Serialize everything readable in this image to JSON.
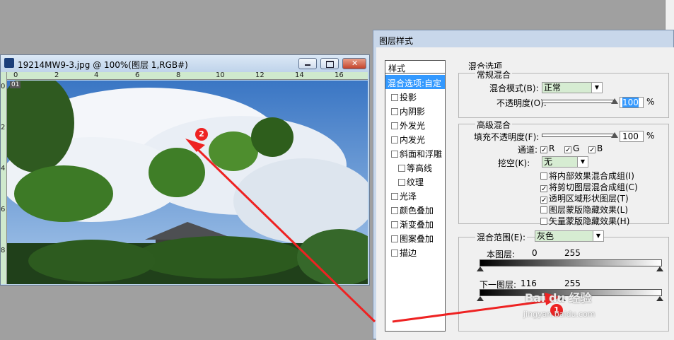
{
  "image_window": {
    "title": "19214MW9-3.jpg @ 100%(图层 1,RGB#)",
    "ruler_top_ticks": [
      "0",
      "2",
      "4",
      "6",
      "8",
      "10",
      "12",
      "14",
      "16"
    ],
    "ruler_left_ticks": [
      "0",
      "2",
      "4",
      "6",
      "8"
    ],
    "layer_badge": "01"
  },
  "dialog": {
    "title": "图层样式",
    "styles_header": "样式",
    "styles": [
      {
        "label": "混合选项:自定",
        "selected": true,
        "checkbox": false
      },
      {
        "label": "投影",
        "checkbox": true
      },
      {
        "label": "内阴影",
        "checkbox": true
      },
      {
        "label": "外发光",
        "checkbox": true
      },
      {
        "label": "内发光",
        "checkbox": true
      },
      {
        "label": "斜面和浮雕",
        "checkbox": true
      },
      {
        "label": "等高线",
        "checkbox": true,
        "indent": true
      },
      {
        "label": "纹理",
        "checkbox": true,
        "indent": true
      },
      {
        "label": "光泽",
        "checkbox": true
      },
      {
        "label": "颜色叠加",
        "checkbox": true
      },
      {
        "label": "渐变叠加",
        "checkbox": true
      },
      {
        "label": "图案叠加",
        "checkbox": true
      },
      {
        "label": "描边",
        "checkbox": true
      }
    ],
    "blend_options_title": "混合选项",
    "general": {
      "title": "常规混合",
      "mode_label": "混合模式(B):",
      "mode_value": "正常",
      "opacity_label": "不透明度(O):",
      "opacity_value": "100",
      "opacity_unit": "%"
    },
    "advanced": {
      "title": "高级混合",
      "fill_label": "填充不透明度(F):",
      "fill_value": "100",
      "fill_unit": "%",
      "channels_label": "通道:",
      "channels": [
        {
          "label": "R",
          "checked": true
        },
        {
          "label": "G",
          "checked": true
        },
        {
          "label": "B",
          "checked": true
        }
      ],
      "knockout_label": "挖空(K):",
      "knockout_value": "无",
      "options": [
        {
          "label": "将内部效果混合成组(I)",
          "checked": false
        },
        {
          "label": "将剪切图层混合成组(C)",
          "checked": true
        },
        {
          "label": "透明区域形状图层(T)",
          "checked": true
        },
        {
          "label": "图层蒙版隐藏效果(L)",
          "checked": false
        },
        {
          "label": "矢量蒙版隐藏效果(H)",
          "checked": false
        }
      ]
    },
    "blend_if": {
      "label": "混合范围(E):",
      "value": "灰色",
      "this_layer_label": "本图层:",
      "this_layer_low": "0",
      "this_layer_high": "255",
      "underlying_label": "下一图层:",
      "underlying_low": "116",
      "underlying_high": "255"
    }
  },
  "annotations": {
    "marker_1": "1",
    "marker_2": "2",
    "arrow_color": "#ee2222"
  },
  "watermark": {
    "brand": "Bai du 经验",
    "url": "jingyan.baidu.com"
  }
}
